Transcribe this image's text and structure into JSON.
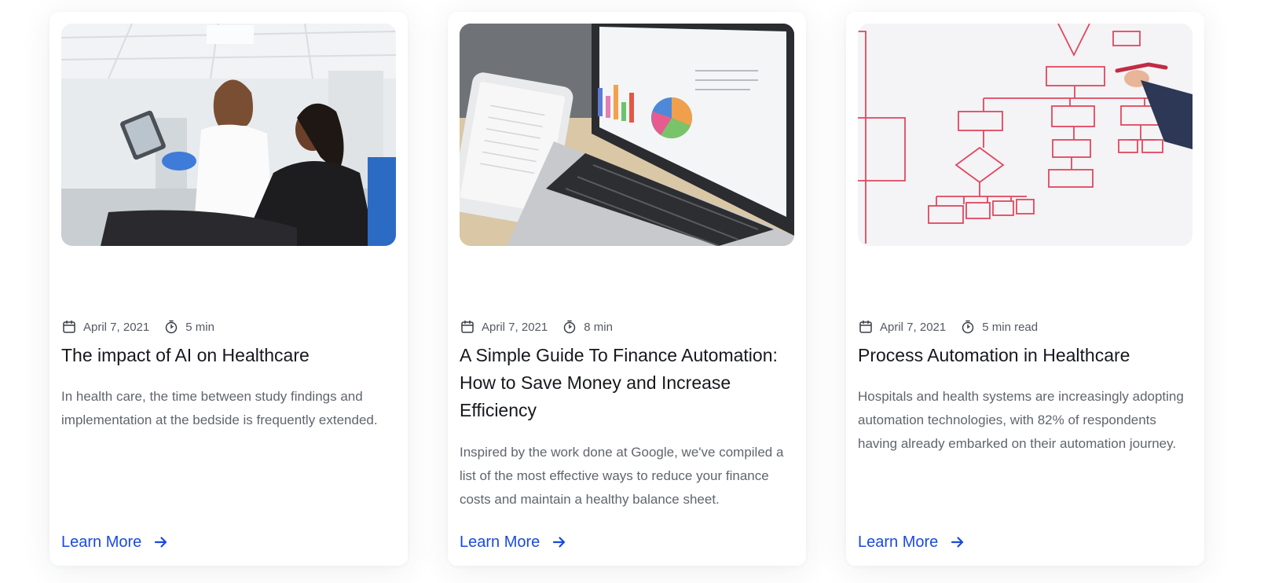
{
  "cards": [
    {
      "image": "healthcare-consultation-photo",
      "date": "April 7, 2021",
      "read_time": "5 min",
      "title": "The impact of AI on Healthcare",
      "excerpt": "In health care, the time between study findings and implementation at the bedside is frequently extended.",
      "cta": "Learn More"
    },
    {
      "image": "laptop-charts-tablet-photo",
      "date": "April 7, 2021",
      "read_time": "8 min",
      "title": "A Simple Guide To Finance Automation: How to Save Money and Increase Efficiency",
      "excerpt": "Inspired by the work done at Google, we've compiled a list of the most effective ways to reduce your finance costs and maintain a healthy balance sheet.",
      "cta": "Learn More"
    },
    {
      "image": "whiteboard-flowchart-photo",
      "date": "April 7, 2021",
      "read_time": "5 min read",
      "title": "Process Automation in Healthcare",
      "excerpt": "Hospitals and health systems are increasingly adopting automation technologies, with 82% of respondents having already embarked on their automation journey.",
      "cta": "Learn More"
    }
  ],
  "icons": {
    "date": "calendar-icon",
    "read_time": "stopwatch-icon",
    "cta": "arrow-right-icon"
  },
  "colors": {
    "link": "#1a49e3",
    "title": "#16181d",
    "body": "#60656e",
    "meta": "#555a63",
    "whiteboard_ink": "#e0475f"
  }
}
